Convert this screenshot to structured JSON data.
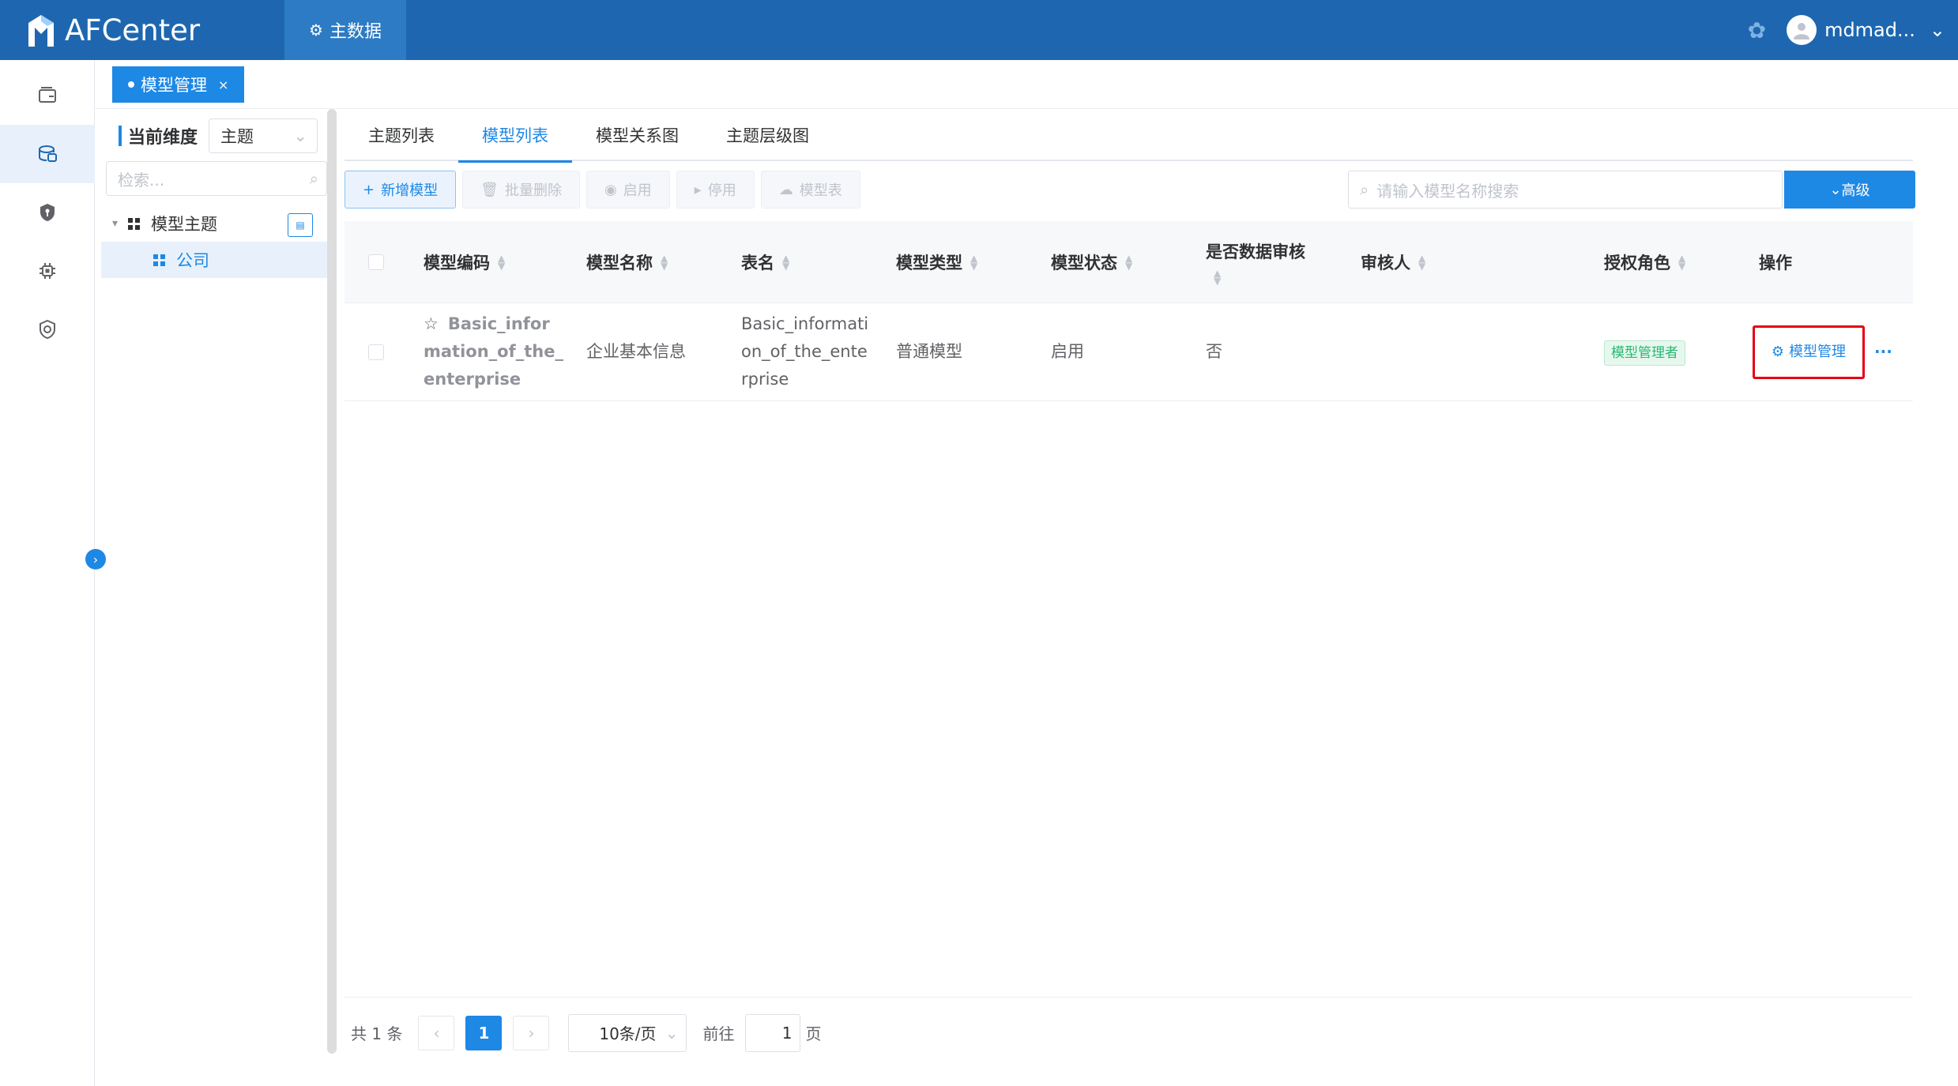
{
  "header": {
    "app_name": "AFCenter",
    "nav_label": "主数据",
    "username": "mdmad...",
    "brand_color": "#1e67b0"
  },
  "page_tab": {
    "label": "模型管理",
    "close": "×"
  },
  "tree": {
    "dimension_label": "当前维度",
    "dimension_value": "主题",
    "search_placeholder": "检索...",
    "root_label": "模型主题",
    "child_label": "公司"
  },
  "tabs": [
    "主题列表",
    "模型列表",
    "模型关系图",
    "主题层级图"
  ],
  "toolbar": {
    "add": "新增模型",
    "batch_delete": "批量删除",
    "enable": "启用",
    "disable": "停用",
    "model_table": "模型表",
    "search_placeholder": "请输入模型名称搜索",
    "advanced": "高级"
  },
  "table": {
    "headers": [
      "模型编码",
      "模型名称",
      "表名",
      "模型类型",
      "模型状态",
      "是否数据审核",
      "审核人",
      "授权角色",
      "操作"
    ],
    "rows": [
      {
        "code_lines": [
          "Basic_infor",
          "mation_of_the_",
          "enterprise"
        ],
        "name": "企业基本信息",
        "table_lines": [
          "Basic_informati",
          "on_of_the_ente",
          "rprise"
        ],
        "type": "普通模型",
        "status": "启用",
        "audit": "否",
        "auditor": "",
        "role": "模型管理者",
        "action": "模型管理",
        "more": "···"
      }
    ]
  },
  "pagination": {
    "total": "共 1 条",
    "current_page": "1",
    "page_size": "10条/页",
    "goto_label": "前往",
    "goto_value": "1",
    "page_suffix": "页"
  }
}
